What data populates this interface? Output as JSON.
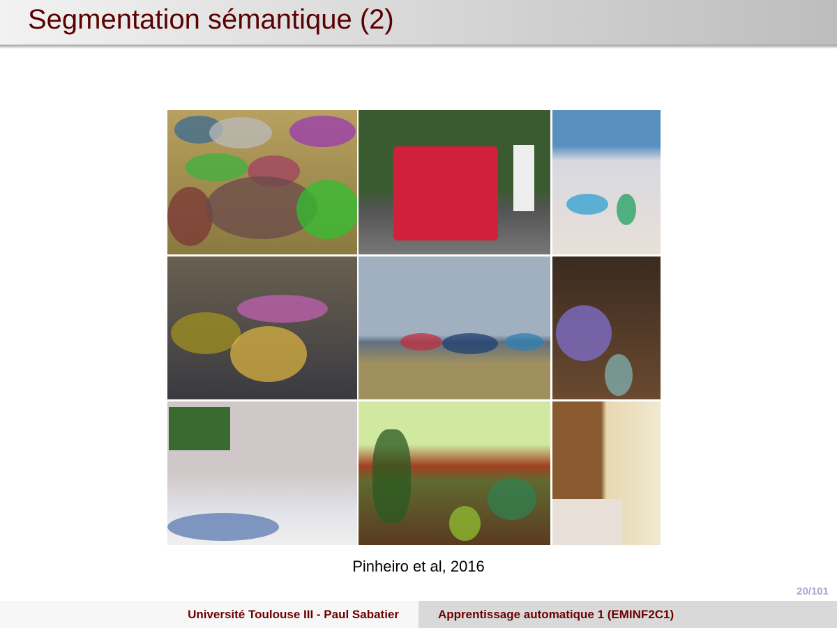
{
  "slide": {
    "title": "Segmentation sémantique (2)",
    "caption": "Pinheiro et al, 2016",
    "page_number": "20/101"
  },
  "footer": {
    "institution": "Université Toulouse III - Paul Sabatier",
    "course": "Apprentissage automatique 1 (EMINF2C1)"
  }
}
